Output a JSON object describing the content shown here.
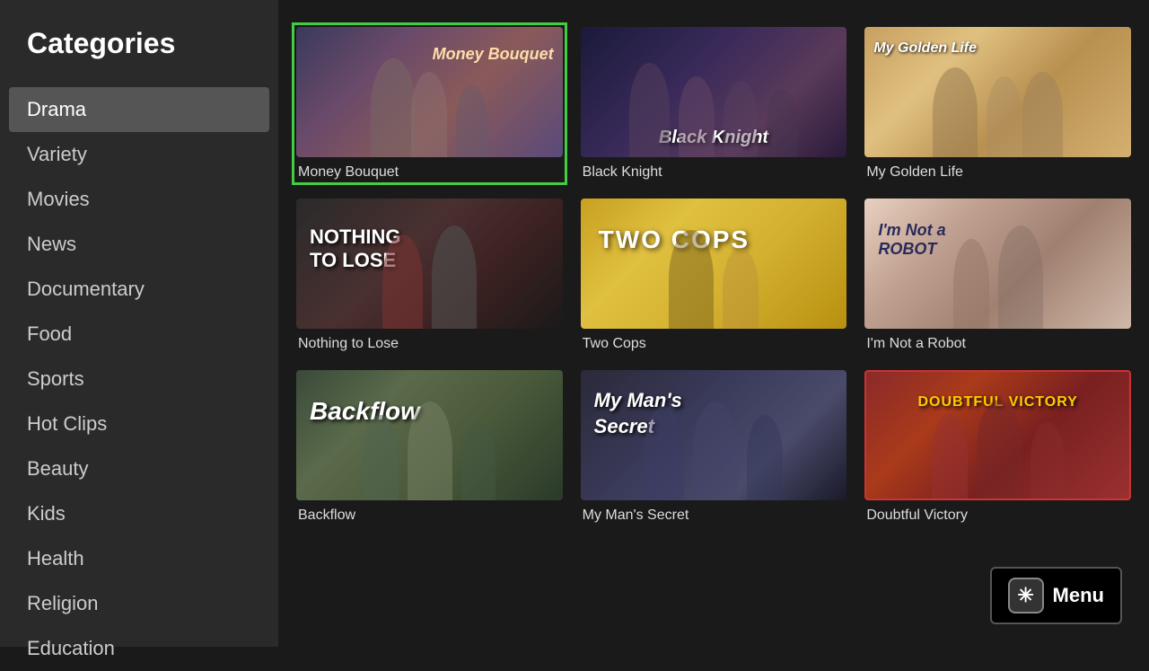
{
  "sidebar": {
    "title": "Categories",
    "items": [
      {
        "label": "Drama",
        "active": true
      },
      {
        "label": "Variety",
        "active": false
      },
      {
        "label": "Movies",
        "active": false
      },
      {
        "label": "News",
        "active": false
      },
      {
        "label": "Documentary",
        "active": false
      },
      {
        "label": "Food",
        "active": false
      },
      {
        "label": "Sports",
        "active": false
      },
      {
        "label": "Hot Clips",
        "active": false
      },
      {
        "label": "Beauty",
        "active": false
      },
      {
        "label": "Kids",
        "active": false
      },
      {
        "label": "Health",
        "active": false
      },
      {
        "label": "Religion",
        "active": false
      },
      {
        "label": "Education",
        "active": false
      }
    ]
  },
  "shows": {
    "row1": [
      {
        "id": "money-bouquet",
        "title": "Money Bouquet",
        "selected": true
      },
      {
        "id": "black-knight",
        "title": "Black Knight",
        "selected": false
      },
      {
        "id": "my-golden-life",
        "title": "My Golden Life",
        "selected": false
      }
    ],
    "row2": [
      {
        "id": "nothing-to-lose",
        "title": "Nothing to Lose",
        "selected": false
      },
      {
        "id": "two-cops",
        "title": "Two Cops",
        "selected": false
      },
      {
        "id": "not-a-robot",
        "title": "I'm Not a Robot",
        "selected": false
      }
    ],
    "row3": [
      {
        "id": "backflow",
        "title": "Backflow",
        "selected": false
      },
      {
        "id": "my-mans-secret",
        "title": "My Man's Secret",
        "selected": false
      },
      {
        "id": "doubtful-victory",
        "title": "Doubtful Victory",
        "selected": false
      }
    ]
  },
  "menu_button": {
    "asterisk": "✳",
    "label": "Menu"
  }
}
